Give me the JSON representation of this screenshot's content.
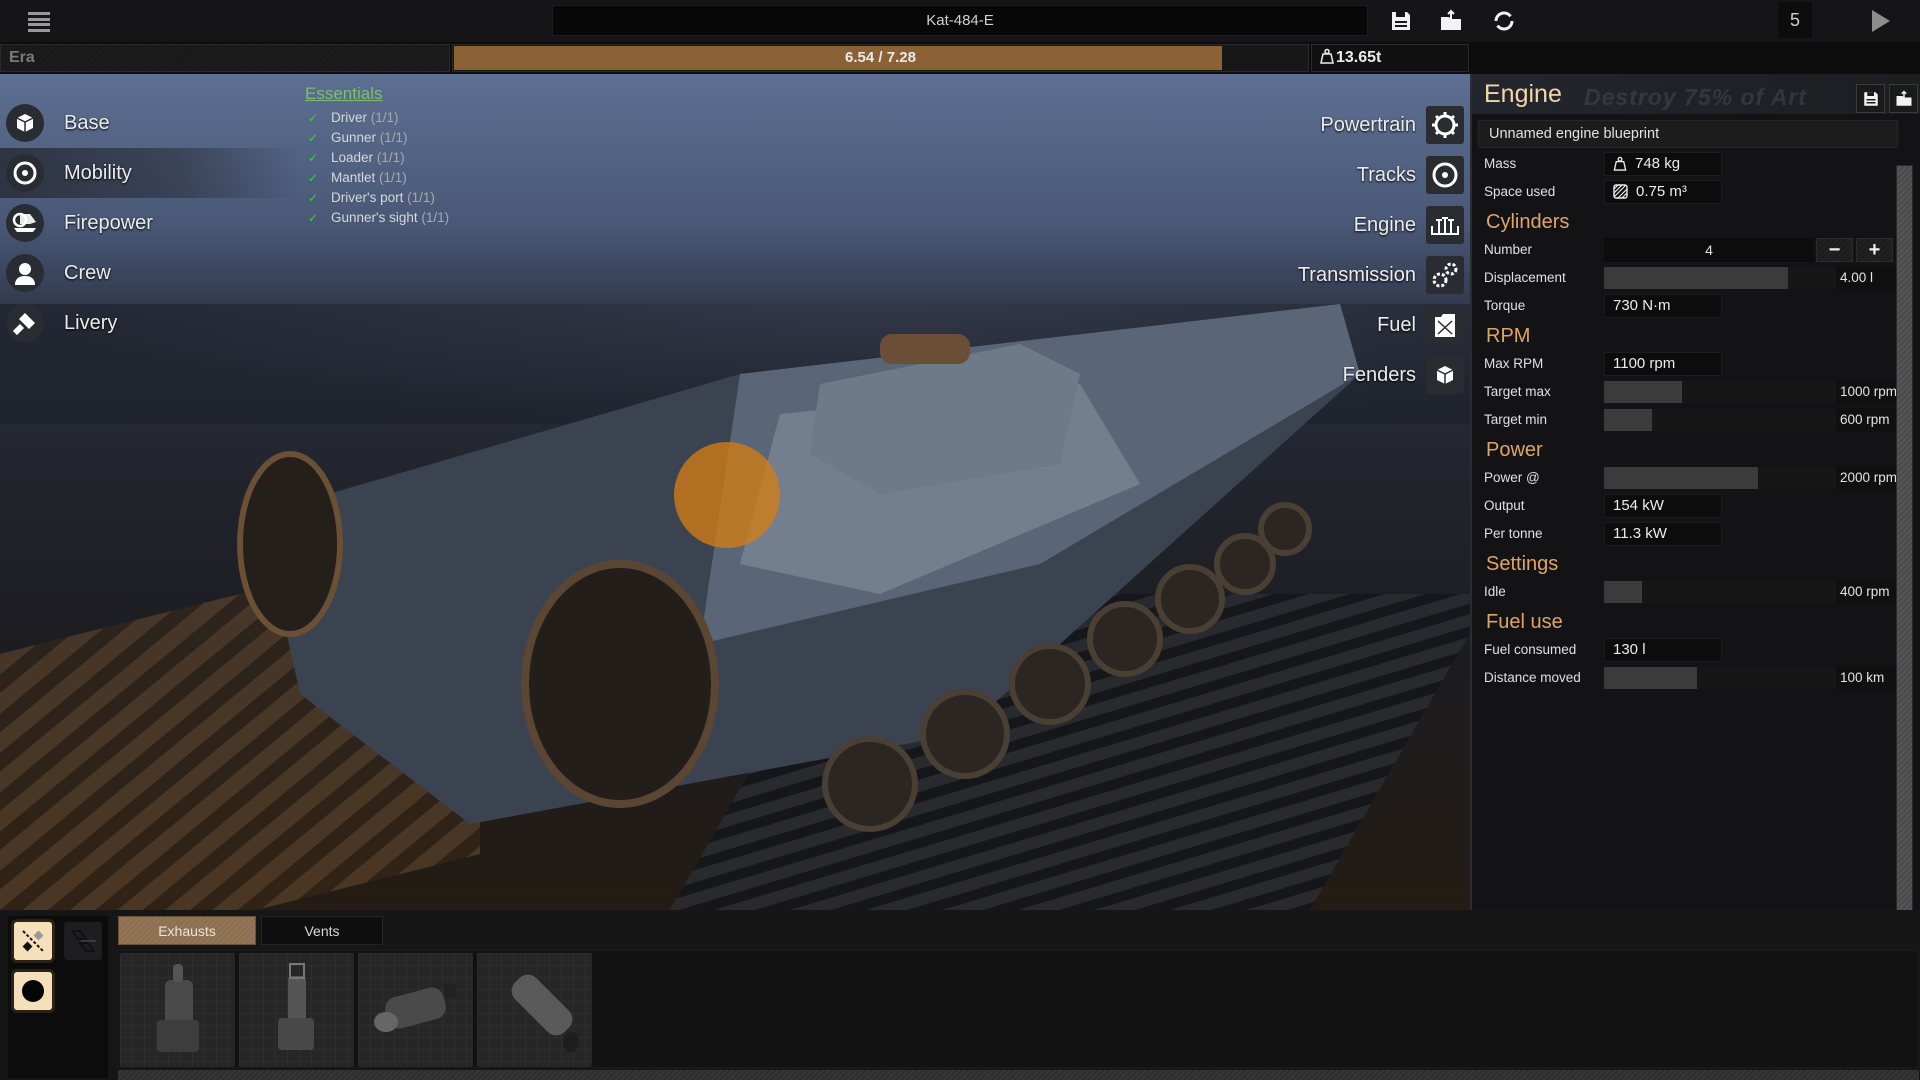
{
  "topbar": {
    "vehicle_name": "Kat-484-E",
    "menu_icon": "hamburger-menu-icon",
    "icons": [
      "save-icon",
      "load-folder-icon",
      "reset-icon"
    ],
    "count": "5",
    "play_icon": "play-icon"
  },
  "statusbar": {
    "era_label": "Era",
    "budget_label": "6.54 / 7.28",
    "budget_used": 6.54,
    "budget_total": 7.28,
    "budget_color": "#8b6236",
    "weight_icon": "weight-icon",
    "weight": "13.65t"
  },
  "nav": {
    "items": [
      {
        "label": "Base",
        "icon": "cube-icon"
      },
      {
        "label": "Mobility",
        "icon": "wheel-icon",
        "active": true
      },
      {
        "label": "Firepower",
        "icon": "turret-icon"
      },
      {
        "label": "Crew",
        "icon": "person-icon"
      },
      {
        "label": "Livery",
        "icon": "paint-brush-icon"
      }
    ]
  },
  "essentials": {
    "title": "Essentials",
    "items": [
      {
        "name": "Driver",
        "count": "(1/1)"
      },
      {
        "name": "Gunner",
        "count": "(1/1)"
      },
      {
        "name": "Loader",
        "count": "(1/1)"
      },
      {
        "name": "Mantlet",
        "count": "(1/1)"
      },
      {
        "name": "Driver's port",
        "count": "(1/1)"
      },
      {
        "name": "Gunner's sight",
        "count": "(1/1)"
      }
    ],
    "check_color": "#37d137"
  },
  "components": {
    "items": [
      {
        "label": "Powertrain",
        "icon": "gear-icon"
      },
      {
        "label": "Tracks",
        "icon": "wheel-icon"
      },
      {
        "label": "Engine",
        "icon": "engine-icon"
      },
      {
        "label": "Transmission",
        "icon": "gears-icon"
      },
      {
        "label": "Fuel",
        "icon": "jerrycan-icon"
      },
      {
        "label": "Fenders",
        "icon": "box-icon"
      }
    ]
  },
  "engine_panel": {
    "title": "Engine",
    "watermark": "Destroy 75% of Art",
    "blueprint_name": "Unnamed engine blueprint",
    "mass_label": "Mass",
    "mass": "748 kg",
    "space_label": "Space used",
    "space": "0.75 m³",
    "sections": {
      "cylinders": "Cylinders",
      "rpm": "RPM",
      "power": "Power",
      "settings": "Settings",
      "fuel_use": "Fuel use"
    },
    "number_label": "Number",
    "number": "4",
    "minus": "−",
    "plus": "+",
    "displacement_label": "Displacement",
    "displacement": "4.00 l",
    "displacement_fraction": 0.73,
    "torque_label": "Torque",
    "torque": "730 N·m",
    "max_rpm_label": "Max RPM",
    "max_rpm": "1100 rpm",
    "target_max_label": "Target max",
    "target_max": "1000 rpm",
    "target_max_fraction": 0.31,
    "target_min_label": "Target min",
    "target_min": "600 rpm",
    "target_min_fraction": 0.19,
    "power_at_label": "Power @",
    "power_at": "2000 rpm",
    "power_at_fraction": 0.61,
    "output_label": "Output",
    "output": "154 kW",
    "per_tonne_label": "Per tonne",
    "per_tonne": "11.3 kW",
    "idle_label": "Idle",
    "idle": "400 rpm",
    "idle_fraction": 0.15,
    "fuel_consumed_label": "Fuel consumed",
    "fuel_consumed": "130 l",
    "distance_label": "Distance moved",
    "distance": "100 km",
    "distance_fraction": 0.37,
    "title_color": "#f2d7a8",
    "section_color": "#dfa565"
  },
  "bottom": {
    "tools": [
      "symmetry-tool-icon",
      "mirror-tool-icon",
      "circle-tool-icon"
    ],
    "tabs": [
      {
        "label": "Exhausts",
        "active": true
      },
      {
        "label": "Vents",
        "active": false
      }
    ],
    "parts": [
      "exhaust-part-1",
      "exhaust-part-2",
      "exhaust-part-3",
      "exhaust-part-4"
    ]
  }
}
